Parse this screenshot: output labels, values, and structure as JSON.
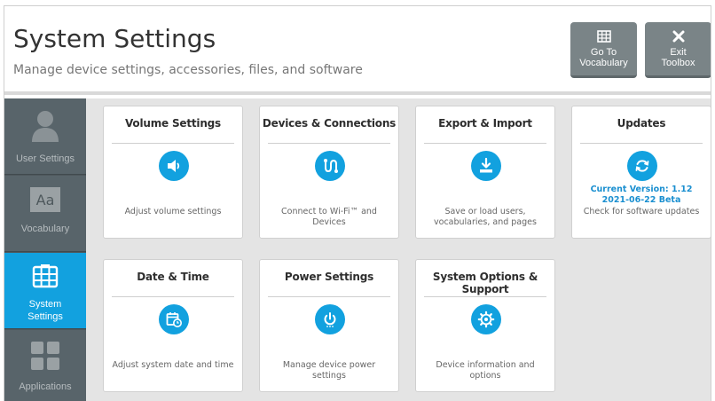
{
  "header": {
    "title": "System Settings",
    "subtitle": "Manage device settings, accessories, files, and software",
    "buttons": [
      {
        "line1": "Go To",
        "line2": "Vocabulary",
        "icon": "grid-icon"
      },
      {
        "line1": "Exit",
        "line2": "Toolbox",
        "icon": "close-icon"
      }
    ]
  },
  "sidebar": {
    "items": [
      {
        "label": "User Settings",
        "icon": "user-icon",
        "active": false
      },
      {
        "label": "Vocabulary",
        "icon": "vocabulary-aa-icon",
        "active": false
      },
      {
        "label": "System Settings",
        "icon": "grid-icon",
        "active": true
      },
      {
        "label": "Applications",
        "icon": "apps-icon",
        "active": false
      }
    ]
  },
  "cards": [
    {
      "title": "Volume Settings",
      "desc": "Adjust volume settings",
      "icon": "speaker-icon"
    },
    {
      "title": "Devices & Connections",
      "desc": "Connect to Wi-Fi™ and Devices",
      "icon": "connection-icon"
    },
    {
      "title": "Export & Import",
      "desc": "Save or load users, vocabularies, and pages",
      "icon": "download-icon"
    },
    {
      "title": "Updates",
      "version": "Current Version: 1.12 2021-06-22 Beta",
      "desc": "Check for software updates",
      "icon": "refresh-icon"
    },
    {
      "title": "Date & Time",
      "desc": "Adjust system date and time",
      "icon": "calendar-clock-icon"
    },
    {
      "title": "Power Settings",
      "desc": "Manage device power settings",
      "icon": "power-icon"
    },
    {
      "title": "System Options & Support",
      "desc": "Device information and options",
      "icon": "gear-icon"
    }
  ],
  "colors": {
    "accent": "#12a1df",
    "sidebar": "#58646a",
    "header_button": "#7a8487",
    "content_bg": "#e4e4e4"
  }
}
